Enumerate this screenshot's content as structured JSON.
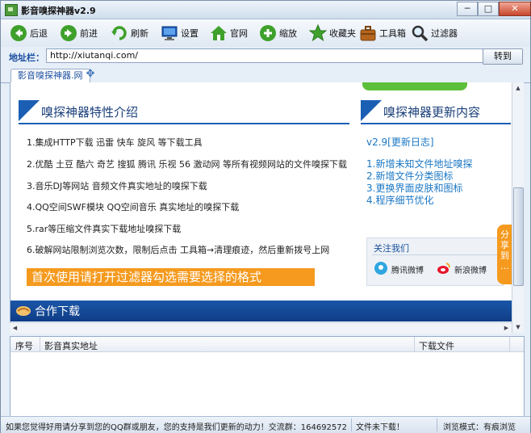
{
  "window": {
    "title": "影音嗅探神器v2.9",
    "min": "─",
    "max": "□",
    "close": "✕"
  },
  "toolbar": [
    {
      "name": "back",
      "label": "后退"
    },
    {
      "name": "forward",
      "label": "前进"
    },
    {
      "name": "refresh",
      "label": "刷新"
    },
    {
      "name": "settings",
      "label": "设置"
    },
    {
      "name": "homepage",
      "label": "官网"
    },
    {
      "name": "zoom",
      "label": "缩放"
    },
    {
      "name": "favorites",
      "label": "收藏夹"
    },
    {
      "name": "toolbox",
      "label": "工具箱"
    },
    {
      "name": "filter",
      "label": "过滤器"
    }
  ],
  "address": {
    "label": "地址栏：",
    "value": "http://xiutanqi.com/",
    "go": "转到"
  },
  "tabs": {
    "active": "影音嗅探神器.网",
    "add": "✥"
  },
  "page": {
    "features_title": "嗅探神器特性介绍",
    "features": [
      "1.集成HTTP下载  迅雷  快车  旋风  等下载工具",
      "2.优酷  土豆  酷六  奇艺  搜狐  腾讯  乐视  56  激动网  等所有视频网站的文件嗅探下载",
      "3.音乐DJ等网站  音频文件真实地址的嗅探下载",
      "4.QQ空间SWF模块  QQ空间音乐  真实地址的嗅探下载",
      "5.rar等压缩文件真实下载地址嗅探下载",
      "6.破解网站限制浏览次数，限制后点击  工具箱→清理痕迹，然后重新拨号上网"
    ],
    "banner": "首次使用请打开过滤器勾选需要选择的格式",
    "update_title": "嗅探神器更新内容",
    "version": "v2.9[更新日志]",
    "updates": [
      "1.新增未知文件地址嗅探",
      "2.新增文件分类图标",
      "3.更换界面皮肤和图标",
      "4.程序细节优化"
    ],
    "follow_title": "关注我们",
    "follow_links": [
      "腾讯微博",
      "新浪微博"
    ],
    "share": [
      "分",
      "享",
      "到",
      "…"
    ],
    "coop_title": "合作下载"
  },
  "list": {
    "columns": [
      "序号",
      "影音真实地址",
      "下载文件"
    ]
  },
  "status": {
    "message": "如果您觉得好用请分享到您的QQ群或朋友，您的支持是我们更新的动力！交流群：164692572",
    "download": "文件未下载！",
    "mode": "浏览模式：有痕浏览"
  },
  "colors": {
    "accent": "#1a5fb4",
    "orange": "#f59a1e",
    "green": "#5cbf3a",
    "link": "#1a77c4"
  }
}
